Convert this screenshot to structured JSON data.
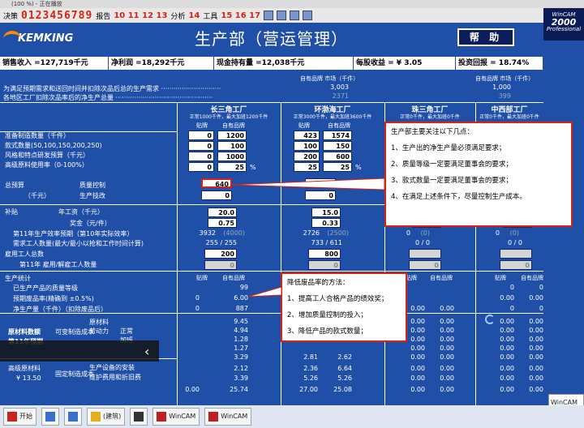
{
  "window": {
    "title": "(100 %) - 正在播放"
  },
  "toolbar": {
    "decision_label": "决策",
    "decision_digits": "0123456789",
    "report_label": "报告",
    "report_digits": "10 11 12 13",
    "analysis_label": "分析",
    "analysis_digits": "14",
    "tools_label": "工具",
    "tools_digits": "15 16 17"
  },
  "header": {
    "logo": "KEMKING",
    "title": "生产部（营运管理）",
    "help_label": "帮 助",
    "wincam_top": "WinCAM",
    "wincam_num": "2000",
    "wincam_bottom": "Professional"
  },
  "kpis": [
    {
      "label": "销售收入 =127,719千元"
    },
    {
      "label": "净利润 =18,292千元"
    },
    {
      "label": "现金持有量 =12,038千元"
    },
    {
      "label": "每股收益 = ¥ 3.05"
    },
    {
      "label": "投资回报 = 18.74%"
    }
  ],
  "top_section": {
    "row1_label": "为满足预期需求和送回时间并扣除次品后总的生产需求 ·····························",
    "row2_label": "各地区工厂扣除次品率后的净生产总量 ···············································",
    "col_head_a": "自有品牌   市场（千件）",
    "col_head_b": "自有品牌   市场（千件）",
    "row1_a": "3,003",
    "row1_b": "1,000",
    "row2_a": "2371",
    "row2_b": "399"
  },
  "plants": [
    {
      "name": "长三角工厂",
      "sub": "正常1000千件，最大加班1200千件"
    },
    {
      "name": "环渤海工厂",
      "sub": "正常3000千件，最大加班3600千件"
    },
    {
      "name": "珠三角工厂",
      "sub": "正常0千件，最大加班0千件"
    },
    {
      "name": "中西部工厂",
      "sub": "正常0千件，最大加班0千件"
    }
  ],
  "col_labels": {
    "brand": "贴牌",
    "own": "自有品牌"
  },
  "rows": {
    "capacity": "准备制造数量（千件）",
    "models": "款式数量(50,100,150,200,250)",
    "rnd": "风格和特点研发预算（千元）",
    "premium": "高级原料使用率（0-100%）",
    "total_budget": "总预算",
    "total_unit": "（千元）",
    "quality": "质量控制",
    "prod_eff": "生产技改",
    "subsidy": "补贴",
    "annual_wage": "年工资（千元）",
    "bonus": "奖金（元/件）",
    "eff11": "第11年生产效率预期（第10年实际效率）",
    "workers_needed": "需求工人数量(最大/最小以抢和工作时间计算)",
    "workers_total": "雇用工人总数",
    "workers_change": "第11年 雇用/解雇工人数量",
    "prod_stats": "生产统计",
    "produced": "已生产产品的质量等级",
    "defect_rate": "预期废品率(精确到 ±0.5%)",
    "net_output": "净生产量（千件）（扣除废品后）",
    "cost_title": "原材料数额",
    "cost_sub": "第11年预期",
    "fixed_cost": "可变制造成本",
    "raw_mat": "原材料",
    "labor": "劳动力",
    "normal": "正常",
    "overtime": "加班",
    "premium_mat": "高级原材料",
    "premium_price": "¥ 13.50",
    "fixed_mfg": "固定制造成本",
    "depr": "生产设备的安装",
    "maint": "维护费用和折旧费"
  },
  "plant_values": {
    "p1": {
      "cap_brand": "0",
      "cap_own": "1200",
      "models_brand": "0",
      "models_own": "100",
      "rnd_brand": "0",
      "rnd_own": "1000",
      "prem_brand": "0",
      "prem_own": "25",
      "pct": "%",
      "quality": "640",
      "prod_eff": "0",
      "wage": "20.0",
      "bonus": "0.75",
      "eff": "3932",
      "eff_prev": "(4000)",
      "workers": "255 / 255",
      "workers_total": "200",
      "workers_change": "0",
      "quality_grade": "99",
      "defect": "6.00",
      "net": "887",
      "costs": [
        "9.45",
        "4.94",
        "1.28",
        "1.27",
        "3.29",
        "2.12",
        "3.39",
        "25.74"
      ]
    },
    "p2": {
      "cap_brand": "423",
      "cap_own": "1574",
      "models_brand": "100",
      "models_own": "150",
      "rnd_brand": "200",
      "rnd_own": "600",
      "prem_brand": "25",
      "prem_own": "25",
      "pct": "%",
      "quality": "1600",
      "prod_eff": "0",
      "wage": "15.0",
      "bonus": "0.33",
      "eff": "2726",
      "eff_prev": "(2500)",
      "workers": "733 / 611",
      "workers_total": "800",
      "workers_change": "0",
      "costs_brand": [
        "2.81",
        "2.36",
        "5.26",
        "27.00"
      ],
      "costs_own": [
        "2.62",
        "6.64",
        "5.26",
        "25.08"
      ]
    },
    "p3": {
      "eff": "0",
      "eff_prev": "(0)",
      "workers": "0 / 0",
      "workers_change": "0",
      "zeros": [
        "0.00",
        "0.00",
        "0.00",
        "0.00",
        "0.00",
        "0.00",
        "0.00",
        "0.00"
      ]
    },
    "p4": {
      "eff": "0",
      "eff_prev": "(0)",
      "workers": "0 / 0",
      "workers_change": "0",
      "zeros": [
        "0.00",
        "0.00",
        "0.00",
        "0.00",
        "0.00",
        "0.00",
        "0.00",
        "0.00"
      ]
    },
    "shared_zero": "0",
    "shared_zero2": "0.00"
  },
  "popup_production": {
    "title": "生产部主要关注以下几点：",
    "items": [
      "1、生产出的净生产量必须满足要求；",
      "2、质量等级一定要满足董事会的要求；",
      "3、款式数量一定要满足董事会的要求；",
      "4、在满足上述条件下，尽量控制生产成本。"
    ]
  },
  "popup_defect": {
    "title": "降低废品率的方法：",
    "items": [
      "1、提高工人合格产品的绩效奖；",
      "2、增加质量控制的投入；",
      "3、降低产品的款式数量；"
    ]
  },
  "taskbar": {
    "items": [
      "开始",
      "",
      "",
      "(建筑)",
      "",
      "WinCAM",
      "WinCAM"
    ],
    "corner": "WinCAM"
  },
  "colors": {
    "bg": "#1f4fa6",
    "accent": "#d21",
    "white": "#ffffff"
  }
}
